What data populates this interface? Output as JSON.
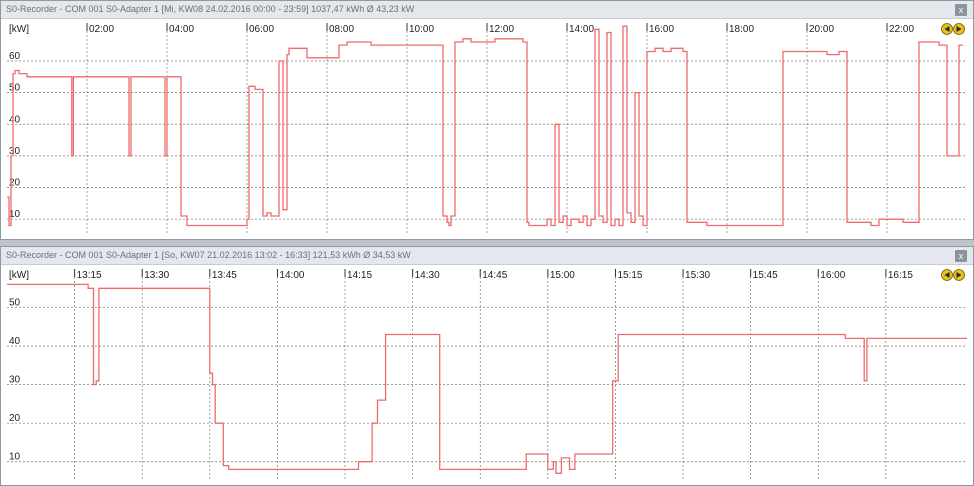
{
  "window": {
    "top_title": "S0-Recorder - COM 001 S0-Adapter 1 [Mi, KW08  24.02.2016 00:00 - 23:59] 1037,47 kWh Ø 43,23 kW",
    "bottom_title": "S0-Recorder - COM 001 S0-Adapter 1 [So, KW07  21.02.2016 13:02 - 16:33] 121,53 kWh Ø 34,53 kW",
    "close_label": "x"
  },
  "icons": [
    "prev-arrow-icon",
    "next-arrow-icon",
    "close-icon"
  ],
  "colors": {
    "series": "#ef6b6b",
    "grid": "#777777",
    "nav_icon": "#e8c21a"
  },
  "chart_data": [
    {
      "type": "line",
      "unit_label": "[kW]",
      "x_ticks": [
        "02:00",
        "04:00",
        "06:00",
        "08:00",
        "10:00",
        "12:00",
        "14:00",
        "16:00",
        "18:00",
        "20:00",
        "22:00"
      ],
      "x_tick_hours": [
        2,
        4,
        6,
        8,
        10,
        12,
        14,
        16,
        18,
        20,
        22
      ],
      "y_ticks": [
        "10",
        "20",
        "30",
        "40",
        "50",
        "60"
      ],
      "y_tick_values": [
        10,
        20,
        30,
        40,
        50,
        60
      ],
      "xlim": [
        0,
        24
      ],
      "ylim": [
        5,
        72
      ],
      "x": [
        0,
        0.05,
        0.1,
        0.15,
        0.2,
        0.3,
        0.5,
        0.9,
        1.6,
        1.62,
        1.66,
        1.7,
        2.1,
        3,
        3.05,
        3.1,
        3.15,
        3.5,
        3.9,
        3.95,
        4.0,
        4.2,
        4.3,
        4.35,
        4.5,
        4.7,
        4.75,
        5.4,
        5.6,
        6.0,
        6.05,
        6.2,
        6.4,
        6.5,
        6.6,
        6.8,
        6.9,
        7.0,
        7.05,
        7.5,
        7.8,
        8.1,
        8.3,
        8.5,
        9.1,
        9.5,
        10.5,
        10.8,
        10.9,
        11.0,
        11.05,
        11.1,
        11.2,
        11.4,
        11.6,
        12.2,
        12.5,
        12.9,
        13.0,
        13.05,
        13.4,
        13.5,
        13.6,
        13.7,
        13.8,
        13.9,
        14.0,
        14.1,
        14.3,
        14.4,
        14.5,
        14.6,
        14.7,
        14.8,
        14.9,
        15.0,
        15.1,
        15.2,
        15.3,
        15.4,
        15.5,
        15.6,
        15.7,
        15.8,
        15.9,
        16.0,
        16.2,
        16.4,
        16.6,
        16.8,
        16.9,
        17.0,
        17.5,
        18.2,
        18.5,
        19.4,
        19.7,
        20.5,
        20.8,
        21.0,
        21.6,
        21.8,
        22.4,
        22.8,
        22.9,
        23.3,
        23.5,
        23.8,
        23.9
      ],
      "y": [
        17,
        8,
        30,
        56,
        57,
        56,
        55,
        55,
        55,
        30,
        55,
        55,
        55,
        55,
        30,
        55,
        55,
        55,
        55,
        30,
        55,
        55,
        55,
        11,
        8,
        8,
        8,
        8,
        8,
        10,
        52,
        51,
        11,
        12,
        11,
        60,
        13,
        62,
        64,
        61,
        61,
        61,
        65,
        66,
        65,
        65,
        65,
        65,
        11,
        9,
        8,
        11,
        66,
        67,
        66,
        67,
        67,
        66,
        9,
        8,
        8,
        10,
        8,
        40,
        9,
        11,
        8,
        10,
        9,
        11,
        8,
        10,
        70,
        11,
        9,
        69,
        8,
        10,
        8,
        71,
        12,
        9,
        50,
        11,
        8,
        63,
        64,
        63,
        64,
        64,
        63,
        9,
        8,
        8,
        8,
        63,
        63,
        62,
        63,
        9,
        8,
        10,
        9,
        66,
        66,
        65,
        30,
        65,
        65,
        64
      ],
      "grid": true
    },
    {
      "type": "line",
      "unit_label": "[kW]",
      "x_ticks": [
        "13:15",
        "13:30",
        "13:45",
        "14:00",
        "14:15",
        "14:30",
        "14:45",
        "15:00",
        "15:15",
        "15:30",
        "15:45",
        "16:00",
        "16:15"
      ],
      "x_tick_hours": [
        13.25,
        13.5,
        13.75,
        14.0,
        14.25,
        14.5,
        14.75,
        15.0,
        15.25,
        15.5,
        15.75,
        16.0,
        16.25
      ],
      "y_ticks": [
        "10",
        "20",
        "30",
        "40",
        "50"
      ],
      "y_tick_values": [
        10,
        20,
        30,
        40,
        50
      ],
      "xlim": [
        13.0,
        16.55
      ],
      "ylim": [
        5,
        60
      ],
      "x": [
        13.0,
        13.1,
        13.2,
        13.2,
        13.28,
        13.3,
        13.32,
        13.33,
        13.34,
        13.36,
        13.45,
        13.55,
        13.6,
        13.65,
        13.74,
        13.75,
        13.76,
        13.77,
        13.8,
        13.82,
        14.0,
        14.1,
        14.2,
        14.22,
        14.28,
        14.3,
        14.35,
        14.37,
        14.4,
        14.5,
        14.55,
        14.58,
        14.6,
        14.8,
        14.9,
        14.92,
        14.95,
        15.0,
        15.02,
        15.03,
        15.05,
        15.08,
        15.1,
        15.15,
        15.2,
        15.22,
        15.24,
        15.26,
        15.3,
        15.5,
        15.8,
        16.0,
        16.1,
        16.16,
        16.17,
        16.18,
        16.2,
        16.3,
        16.55
      ],
      "y": [
        56,
        56,
        56,
        56,
        56,
        55,
        30,
        31,
        55,
        55,
        55,
        55,
        55,
        55,
        55,
        33,
        30,
        20,
        9,
        8,
        8,
        8,
        8,
        8,
        8,
        10,
        20,
        26,
        43,
        43,
        43,
        43,
        8,
        8,
        8,
        12,
        12,
        8,
        10,
        7,
        11,
        8,
        12,
        12,
        12,
        12,
        31,
        43,
        43,
        43,
        43,
        43,
        42,
        42,
        31,
        42,
        42,
        42,
        42
      ],
      "grid": true
    }
  ]
}
